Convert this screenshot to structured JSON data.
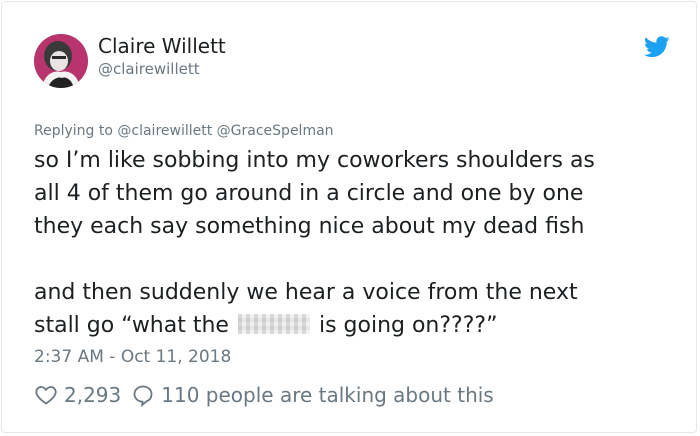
{
  "author": {
    "name": "Claire Willett",
    "handle": "@clairewillett"
  },
  "reply": {
    "prefix": "Replying to",
    "mentions": [
      "@clairewillett",
      "@GraceSpelman"
    ]
  },
  "tweet": {
    "lines": [
      "so I’m like sobbing into my coworkers shoulders as",
      "all 4 of them go around in a circle and one by one",
      "they each say something nice about my dead fish",
      "and then suddenly we hear a voice from the next",
      "stall go “what the",
      "is going on????”"
    ]
  },
  "timestamp": "2:37 AM - Oct 11, 2018",
  "engagement": {
    "likes": "2,293",
    "talking": "110 people are talking about this"
  },
  "colors": {
    "twitter_blue": "#1da1f2",
    "text": "#1c2022",
    "muted": "#697882"
  },
  "icons": {
    "brand": "twitter-bird-icon",
    "like": "heart-icon",
    "reply": "speech-bubble-icon"
  }
}
